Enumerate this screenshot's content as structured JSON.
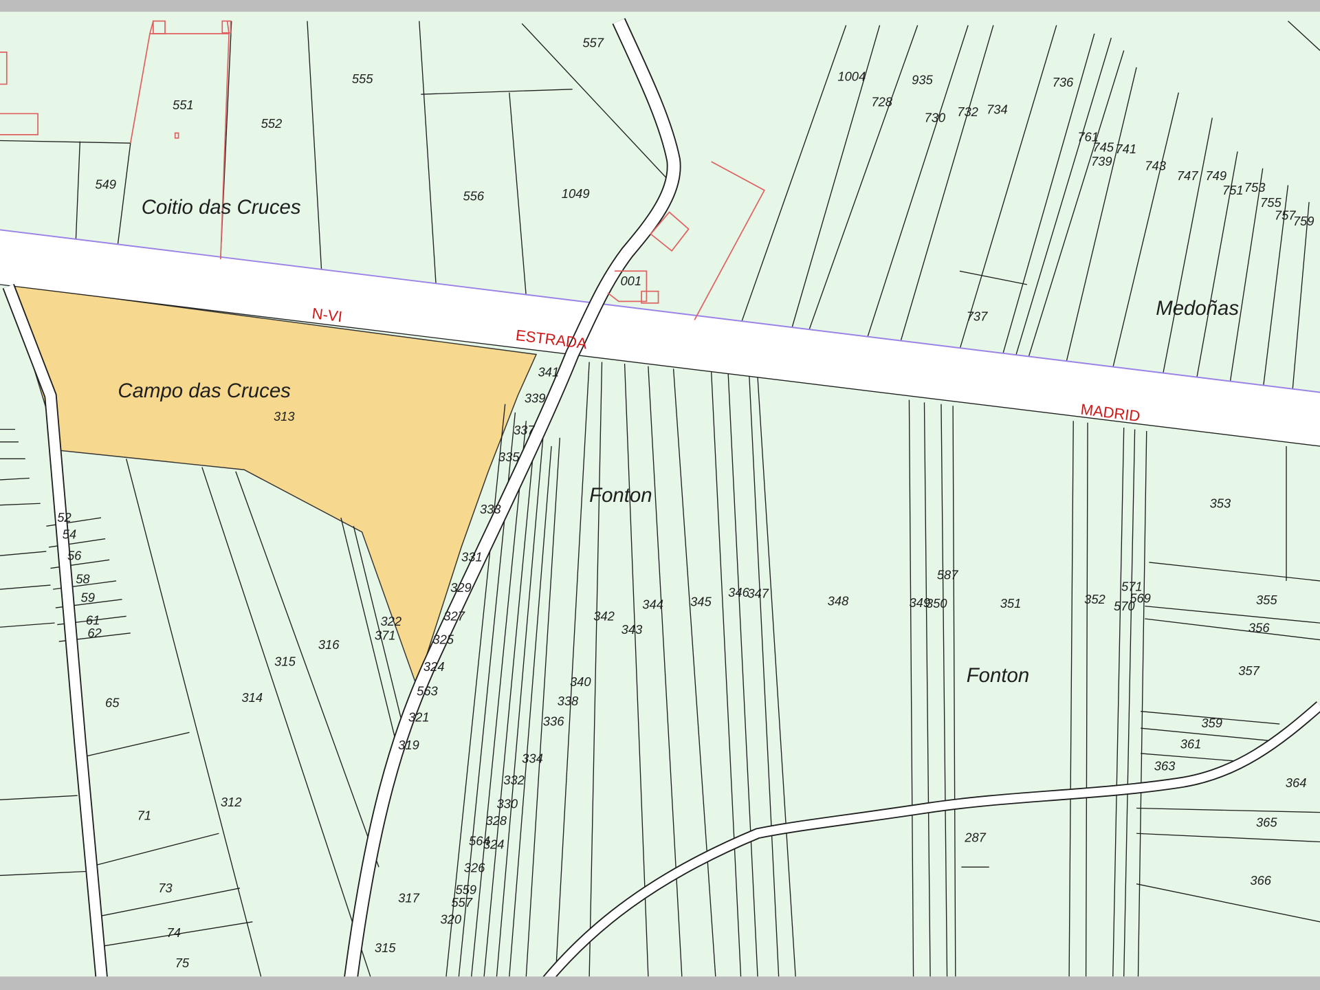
{
  "map": {
    "colors": {
      "background": "#e6f7e8",
      "highlight_fill": "#f6d98e",
      "road_fill": "#ffffff",
      "parcel_line": "#1f1f1f",
      "road_edge": "#9b82e6",
      "building_line": "#e06060",
      "road_label": "#d01818",
      "frame": "#bdbdbd"
    },
    "highway_labels": [
      "N-VI",
      "ESTRADA",
      "MADRID"
    ],
    "place_names": [
      "Coitio das Cruces",
      "Campo das Cruces",
      "Fonton",
      "Fonton",
      "Medoñas"
    ],
    "parcel_numbers": [
      "555",
      "557",
      "551",
      "552",
      "549",
      "556",
      "1049",
      "1004",
      "935",
      "728",
      "730",
      "732",
      "734",
      "736",
      "761",
      "745",
      "739",
      "741",
      "743",
      "747",
      "749",
      "751",
      "753",
      "755",
      "757",
      "759",
      "737",
      "001",
      "313",
      "341",
      "339",
      "337",
      "335",
      "333",
      "331",
      "329",
      "327",
      "325",
      "324",
      "563",
      "321",
      "319",
      "322",
      "371",
      "316",
      "315",
      "314",
      "312",
      "317",
      "315",
      "52",
      "54",
      "56",
      "58",
      "59",
      "61",
      "62",
      "65",
      "71",
      "73",
      "74",
      "75",
      "342",
      "344",
      "345",
      "346",
      "347",
      "348",
      "349",
      "350",
      "351",
      "352",
      "343",
      "340",
      "338",
      "336",
      "334",
      "332",
      "330",
      "328",
      "564",
      "324",
      "326",
      "559",
      "557",
      "320",
      "353",
      "587",
      "571",
      "570",
      "569",
      "355",
      "356",
      "357",
      "359",
      "361",
      "363",
      "364",
      "365",
      "366",
      "287"
    ]
  }
}
